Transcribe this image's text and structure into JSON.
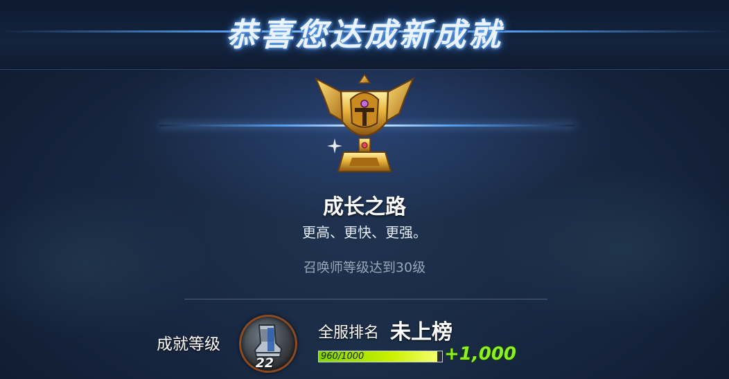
{
  "header": {
    "title": "恭喜您达成新成就"
  },
  "achievement": {
    "icon": "gold-trophy-icon",
    "name": "成长之路",
    "description": "更高、更快、更强。",
    "requirement": "召唤师等级达到30级"
  },
  "footer": {
    "achievement_level_label": "成就等级",
    "badge": {
      "icon": "armored-boot-icon",
      "level": "22"
    },
    "server_rank_label": "全服排名",
    "server_rank_value": "未上榜",
    "progress": {
      "text": "960/1000",
      "current": 960,
      "max": 1000,
      "fraction": 0.96
    },
    "points_gained": "+1,000"
  },
  "colors": {
    "title_glow": "#6fb4ff",
    "accent_blue": "#5aaaff",
    "progress_green": "#8cf021",
    "trophy_gold": "#e8b43a"
  }
}
